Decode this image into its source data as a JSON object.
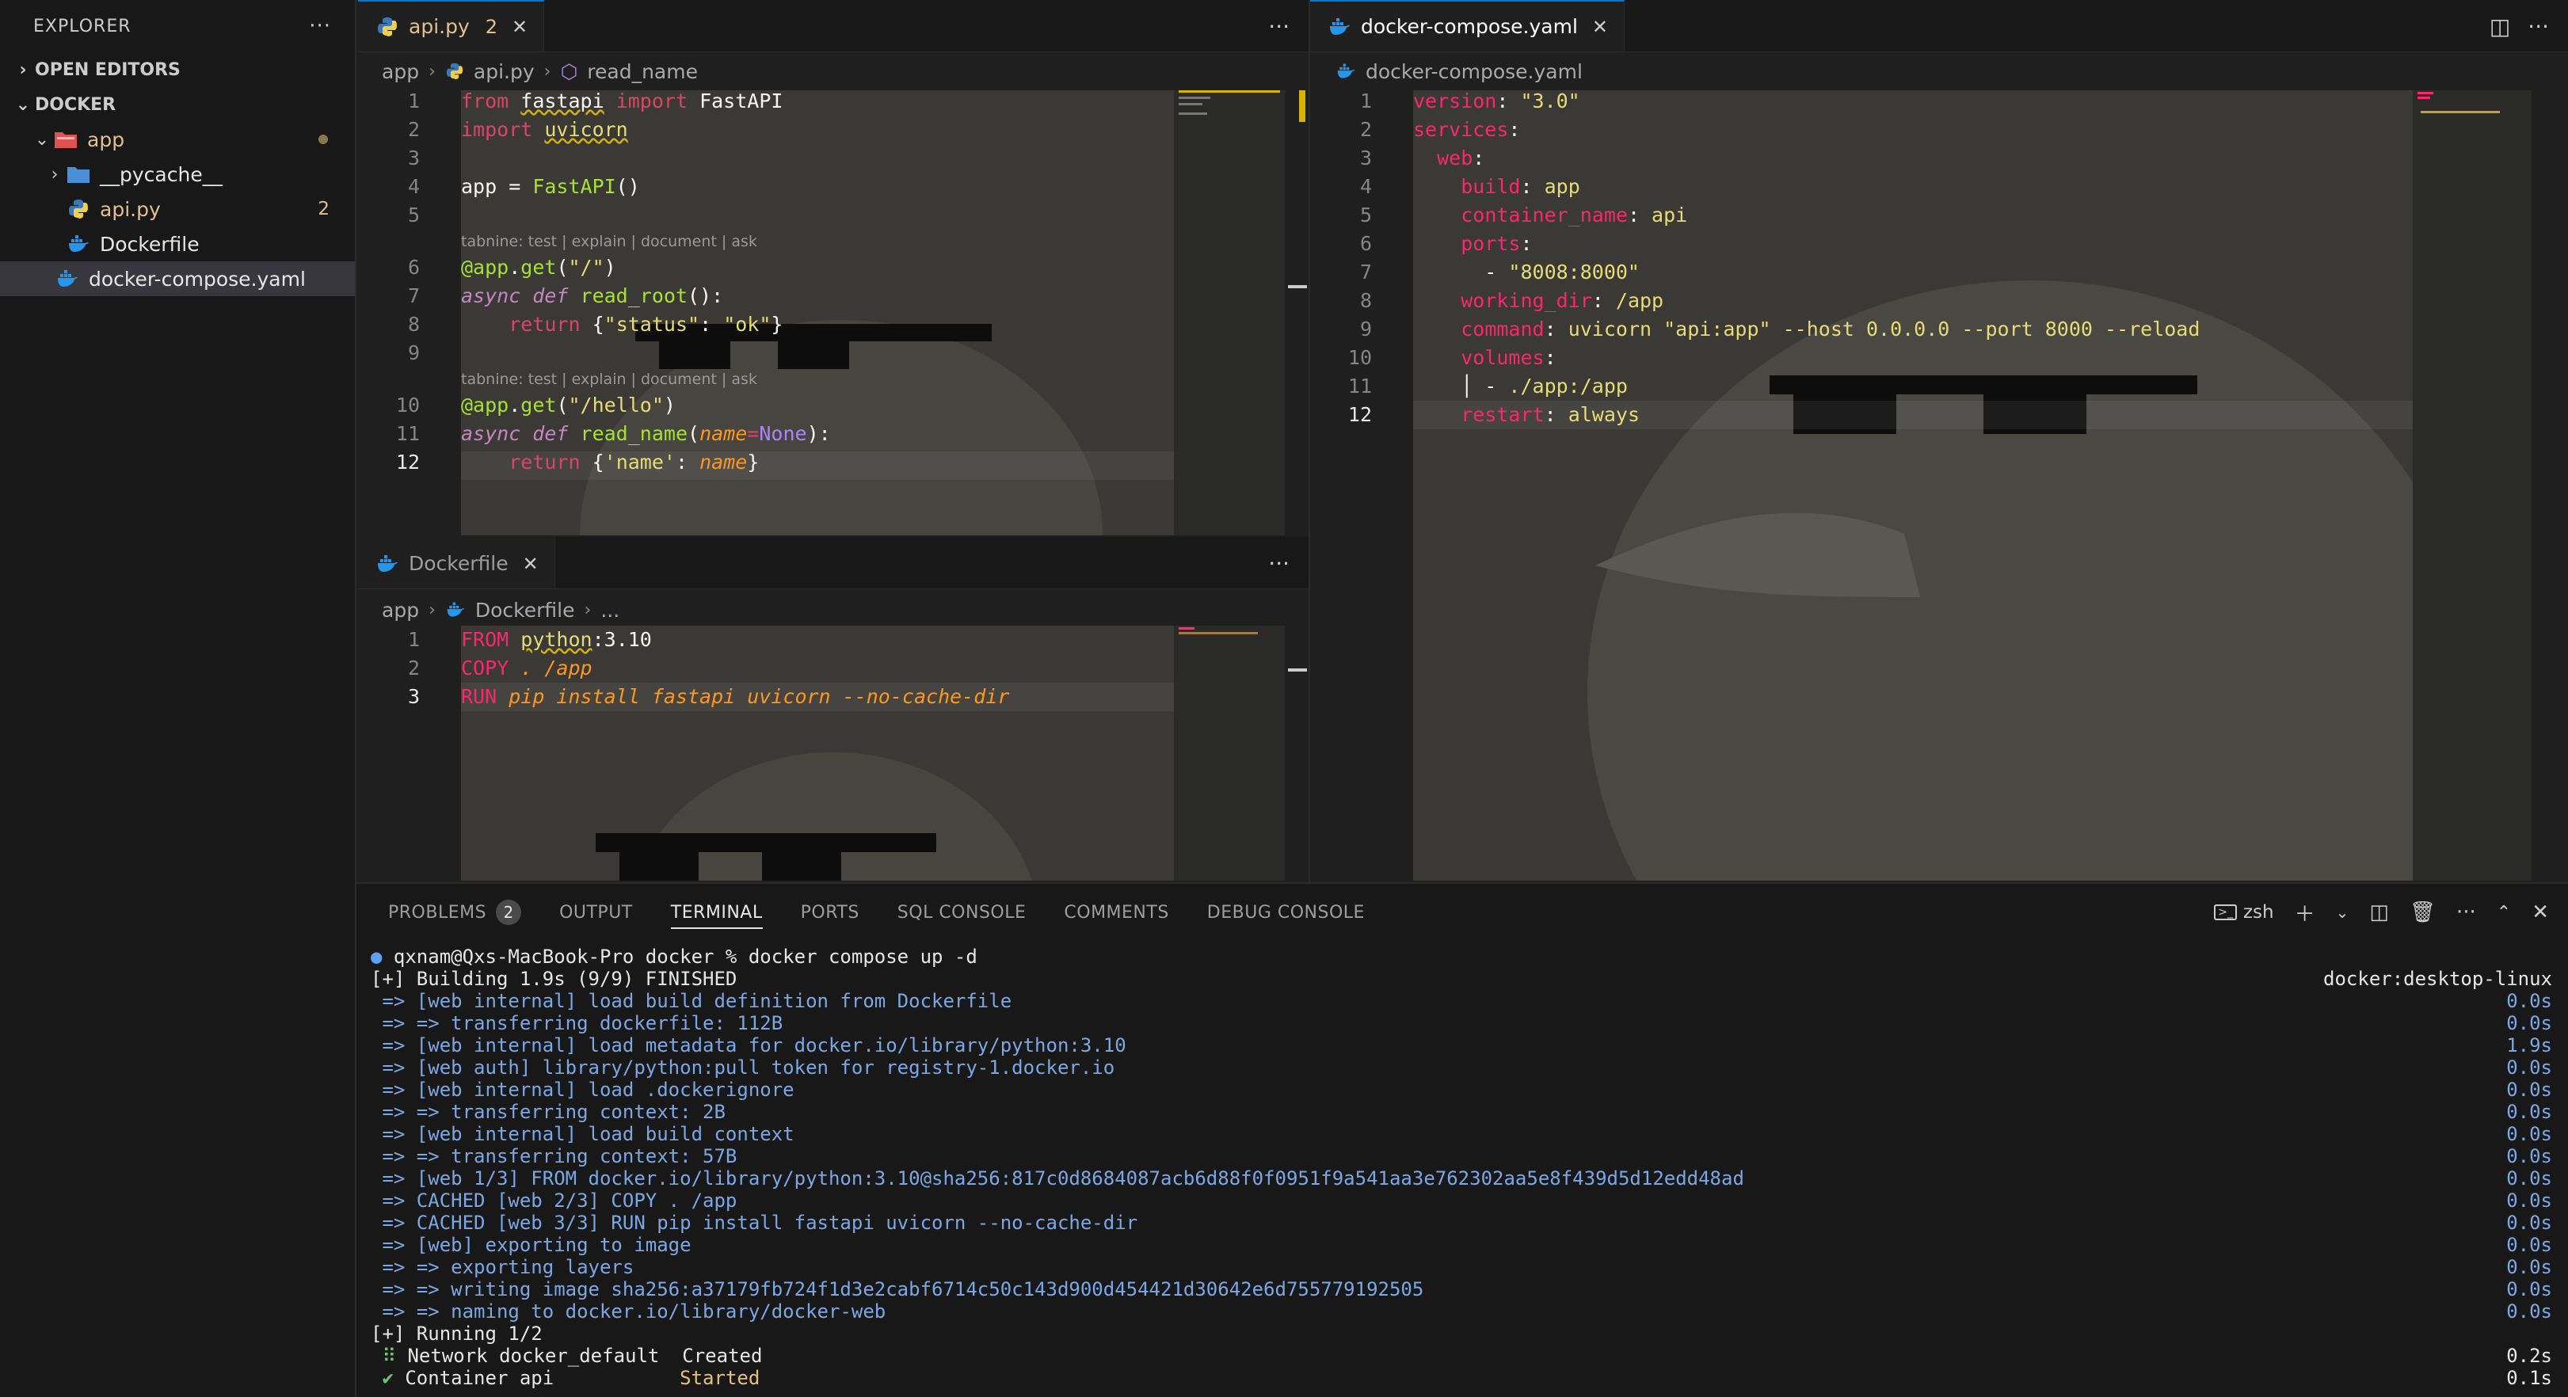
{
  "explorer": {
    "title": "EXPLORER",
    "more": "···",
    "open_editors": "OPEN EDITORS",
    "workspace": "DOCKER",
    "items": [
      {
        "label": "app",
        "level": 1,
        "type": "folder-open",
        "color": "#f14c4c"
      },
      {
        "label": "__pycache__",
        "level": 2,
        "type": "folder"
      },
      {
        "label": "api.py",
        "level": 2,
        "type": "python",
        "badge": "2",
        "color": "#e2c08d"
      },
      {
        "label": "Dockerfile",
        "level": 2,
        "type": "docker"
      },
      {
        "label": "docker-compose.yaml",
        "level": 1,
        "type": "docker",
        "selected": true
      }
    ]
  },
  "editor_api": {
    "tab": "api.py",
    "tab_count": "2",
    "breadcrumb": [
      "app",
      "api.py",
      "read_name"
    ],
    "codelens": "tabnine: test | explain | document | ask"
  },
  "editor_dockerfile": {
    "tab": "Dockerfile",
    "breadcrumb": [
      "app",
      "Dockerfile",
      "..."
    ]
  },
  "editor_compose": {
    "tab": "docker-compose.yaml",
    "breadcrumb": "docker-compose.yaml"
  },
  "panel": {
    "tabs": [
      "PROBLEMS",
      "OUTPUT",
      "TERMINAL",
      "PORTS",
      "SQL CONSOLE",
      "COMMENTS",
      "DEBUG CONSOLE"
    ],
    "problems_count": "2",
    "active_tab": "TERMINAL",
    "shell": "zsh",
    "terminal": {
      "prompt": "qxnam@Qxs-MacBook-Pro docker % docker compose up -d",
      "building": "[+] Building 1.9s (9/9) FINISHED",
      "context": "docker:desktop-linux",
      "steps": [
        {
          "text": " => [web internal] load build definition from Dockerfile",
          "time": "0.0s"
        },
        {
          "text": " => => transferring dockerfile: 112B",
          "time": "0.0s"
        },
        {
          "text": " => [web internal] load metadata for docker.io/library/python:3.10",
          "time": "1.9s"
        },
        {
          "text": " => [web auth] library/python:pull token for registry-1.docker.io",
          "time": "0.0s"
        },
        {
          "text": " => [web internal] load .dockerignore",
          "time": "0.0s"
        },
        {
          "text": " => => transferring context: 2B",
          "time": "0.0s"
        },
        {
          "text": " => [web internal] load build context",
          "time": "0.0s"
        },
        {
          "text": " => => transferring context: 57B",
          "time": "0.0s"
        },
        {
          "text": " => [web 1/3] FROM docker.io/library/python:3.10@sha256:817c0d8684087acb6d88f0f0951f9a541aa3e762302aa5e8f439d5d12edd48ad",
          "time": "0.0s"
        },
        {
          "text": " => CACHED [web 2/3] COPY . /app",
          "time": "0.0s"
        },
        {
          "text": " => CACHED [web 3/3] RUN pip install fastapi uvicorn --no-cache-dir",
          "time": "0.0s"
        },
        {
          "text": " => [web] exporting to image",
          "time": "0.0s"
        },
        {
          "text": " => => exporting layers",
          "time": "0.0s"
        },
        {
          "text": " => => writing image sha256:a37179fb724f1d3e2cabf6714c50c143d900d454421d30642e6d755779192505",
          "time": "0.0s"
        },
        {
          "text": " => => naming to docker.io/library/docker-web",
          "time": "0.0s"
        }
      ],
      "running": "[+] Running 1/2",
      "network": {
        "icon": "⠿",
        "name": "Network docker_default",
        "status": "Created",
        "time": "0.2s"
      },
      "container": {
        "icon": "✔",
        "name": "Container api",
        "status": "Started",
        "time": "0.1s"
      }
    }
  }
}
